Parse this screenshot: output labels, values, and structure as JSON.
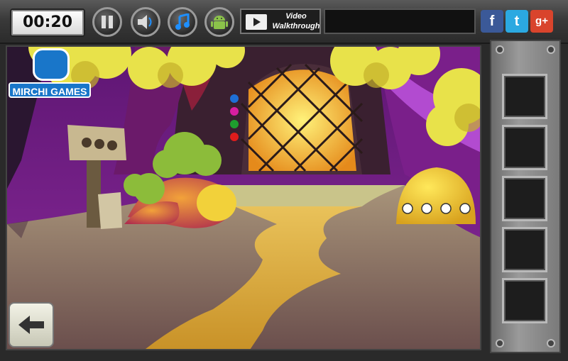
{
  "topbar": {
    "timer": "00:20",
    "video_line1": "Video",
    "video_line2": "Walkthrough",
    "social": {
      "facebook": "f",
      "twitter": "t",
      "googleplus": "g+"
    }
  },
  "logo": {
    "text": "MIRCHI GAMES"
  },
  "inventory": {
    "slots": 5
  },
  "colors": {
    "dots": [
      "#1e6fd6",
      "#d81ea0",
      "#1e9e2e",
      "#e01c1c"
    ]
  }
}
